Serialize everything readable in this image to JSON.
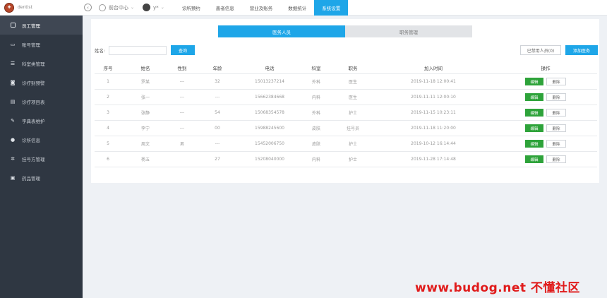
{
  "header": {
    "logo_text": "dentist",
    "clinic_label": "前台中心",
    "user_label": "y*",
    "nav": [
      {
        "label": "诊所预约"
      },
      {
        "label": "患者信息"
      },
      {
        "label": "营业及账务"
      },
      {
        "label": "数据统计"
      },
      {
        "label": "系统设置"
      }
    ]
  },
  "sidebar": {
    "items": [
      {
        "label": "员工管理",
        "icon": "phone-icon"
      },
      {
        "label": "账号管理",
        "icon": "id-card-icon"
      },
      {
        "label": "科室类管理",
        "icon": "list-icon"
      },
      {
        "label": "诊疗别预警",
        "icon": "camera-icon"
      },
      {
        "label": "诊疗项目表",
        "icon": "book-icon"
      },
      {
        "label": "字典表维护",
        "icon": "pencil-icon"
      },
      {
        "label": "诊所信息",
        "icon": "info-icon"
      },
      {
        "label": "挂号方管理",
        "icon": "gear-icon"
      },
      {
        "label": "药品管理",
        "icon": "briefcase-icon"
      }
    ]
  },
  "tabs": [
    {
      "label": "医务人员"
    },
    {
      "label": "职务管理"
    }
  ],
  "search": {
    "label": "姓名:",
    "value": "",
    "button": "查询"
  },
  "actions": {
    "disabled_label": "已禁用人员(0)",
    "add_label": "添加医务"
  },
  "table": {
    "columns": [
      "序号",
      "姓名",
      "性别",
      "年龄",
      "电话",
      "科室",
      "职务",
      "加入时间",
      "操作"
    ],
    "rows": [
      {
        "no": "1",
        "name": "罗某",
        "gender": "---",
        "age": "32",
        "phone": "15013237214",
        "dept": "外科",
        "title": "医生",
        "joined": "2019-11-18 12:00:41"
      },
      {
        "no": "2",
        "name": "张一",
        "gender": "---",
        "age": "---",
        "phone": "15662384668",
        "dept": "内科",
        "title": "医生",
        "joined": "2019-11-11 12:00:10"
      },
      {
        "no": "3",
        "name": "张静",
        "gender": "---",
        "age": "54",
        "phone": "15068354578",
        "dept": "外科",
        "title": "护士",
        "joined": "2019-11-15 10:23:11"
      },
      {
        "no": "4",
        "name": "李宁",
        "gender": "---",
        "age": "00",
        "phone": "15988245600",
        "dept": "皮肤",
        "title": "挂号员",
        "joined": "2019-11-18 11:20:00"
      },
      {
        "no": "5",
        "name": "周文",
        "gender": "男",
        "age": "---",
        "phone": "15452006750",
        "dept": "皮肤",
        "title": "护士",
        "joined": "2019-10-12 16:14:44"
      },
      {
        "no": "6",
        "name": "杨五",
        "gender": "",
        "age": "27",
        "phone": "15208040000",
        "dept": "内科",
        "title": "护士",
        "joined": "2019-11-28 17:14:48"
      }
    ],
    "edit_label": "编辑",
    "delete_label": "删除"
  },
  "watermark": "www.budog.net 不懂社区"
}
